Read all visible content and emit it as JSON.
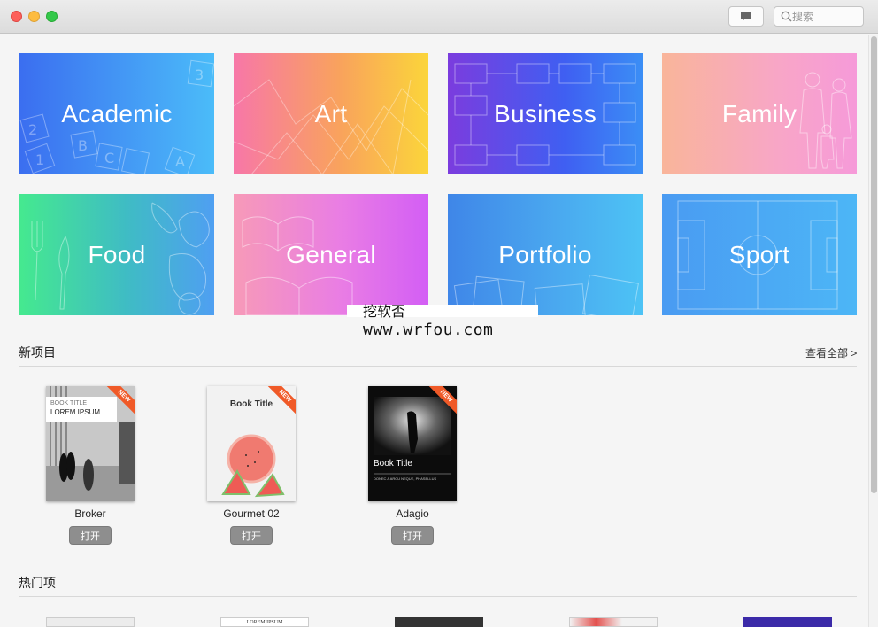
{
  "window": {
    "search_placeholder": "搜索"
  },
  "categories": [
    {
      "label": "Academic"
    },
    {
      "label": "Art"
    },
    {
      "label": "Business"
    },
    {
      "label": "Family"
    },
    {
      "label": "Food"
    },
    {
      "label": "General"
    },
    {
      "label": "Portfolio"
    },
    {
      "label": "Sport"
    }
  ],
  "new_projects": {
    "title": "新项目",
    "view_all": "查看全部 >",
    "items": [
      {
        "name": "Broker",
        "open_label": "打开",
        "badge": "NEW",
        "cover_title": "BOOK TITLE",
        "cover_subtitle": "LOREM IPSUM"
      },
      {
        "name": "Gourmet 02",
        "open_label": "打开",
        "badge": "NEW",
        "cover_title": "Book Title"
      },
      {
        "name": "Adagio",
        "open_label": "打开",
        "badge": "NEW",
        "cover_title": "Book Title",
        "cover_subtitle": "DONEC A ARCU NEQUE, PHASELLUS"
      }
    ]
  },
  "popular": {
    "title": "热门项",
    "peek_text": "LOREM IPSUM"
  },
  "watermark": {
    "line1": "挖软否",
    "line2": "www.wrfou.com"
  }
}
